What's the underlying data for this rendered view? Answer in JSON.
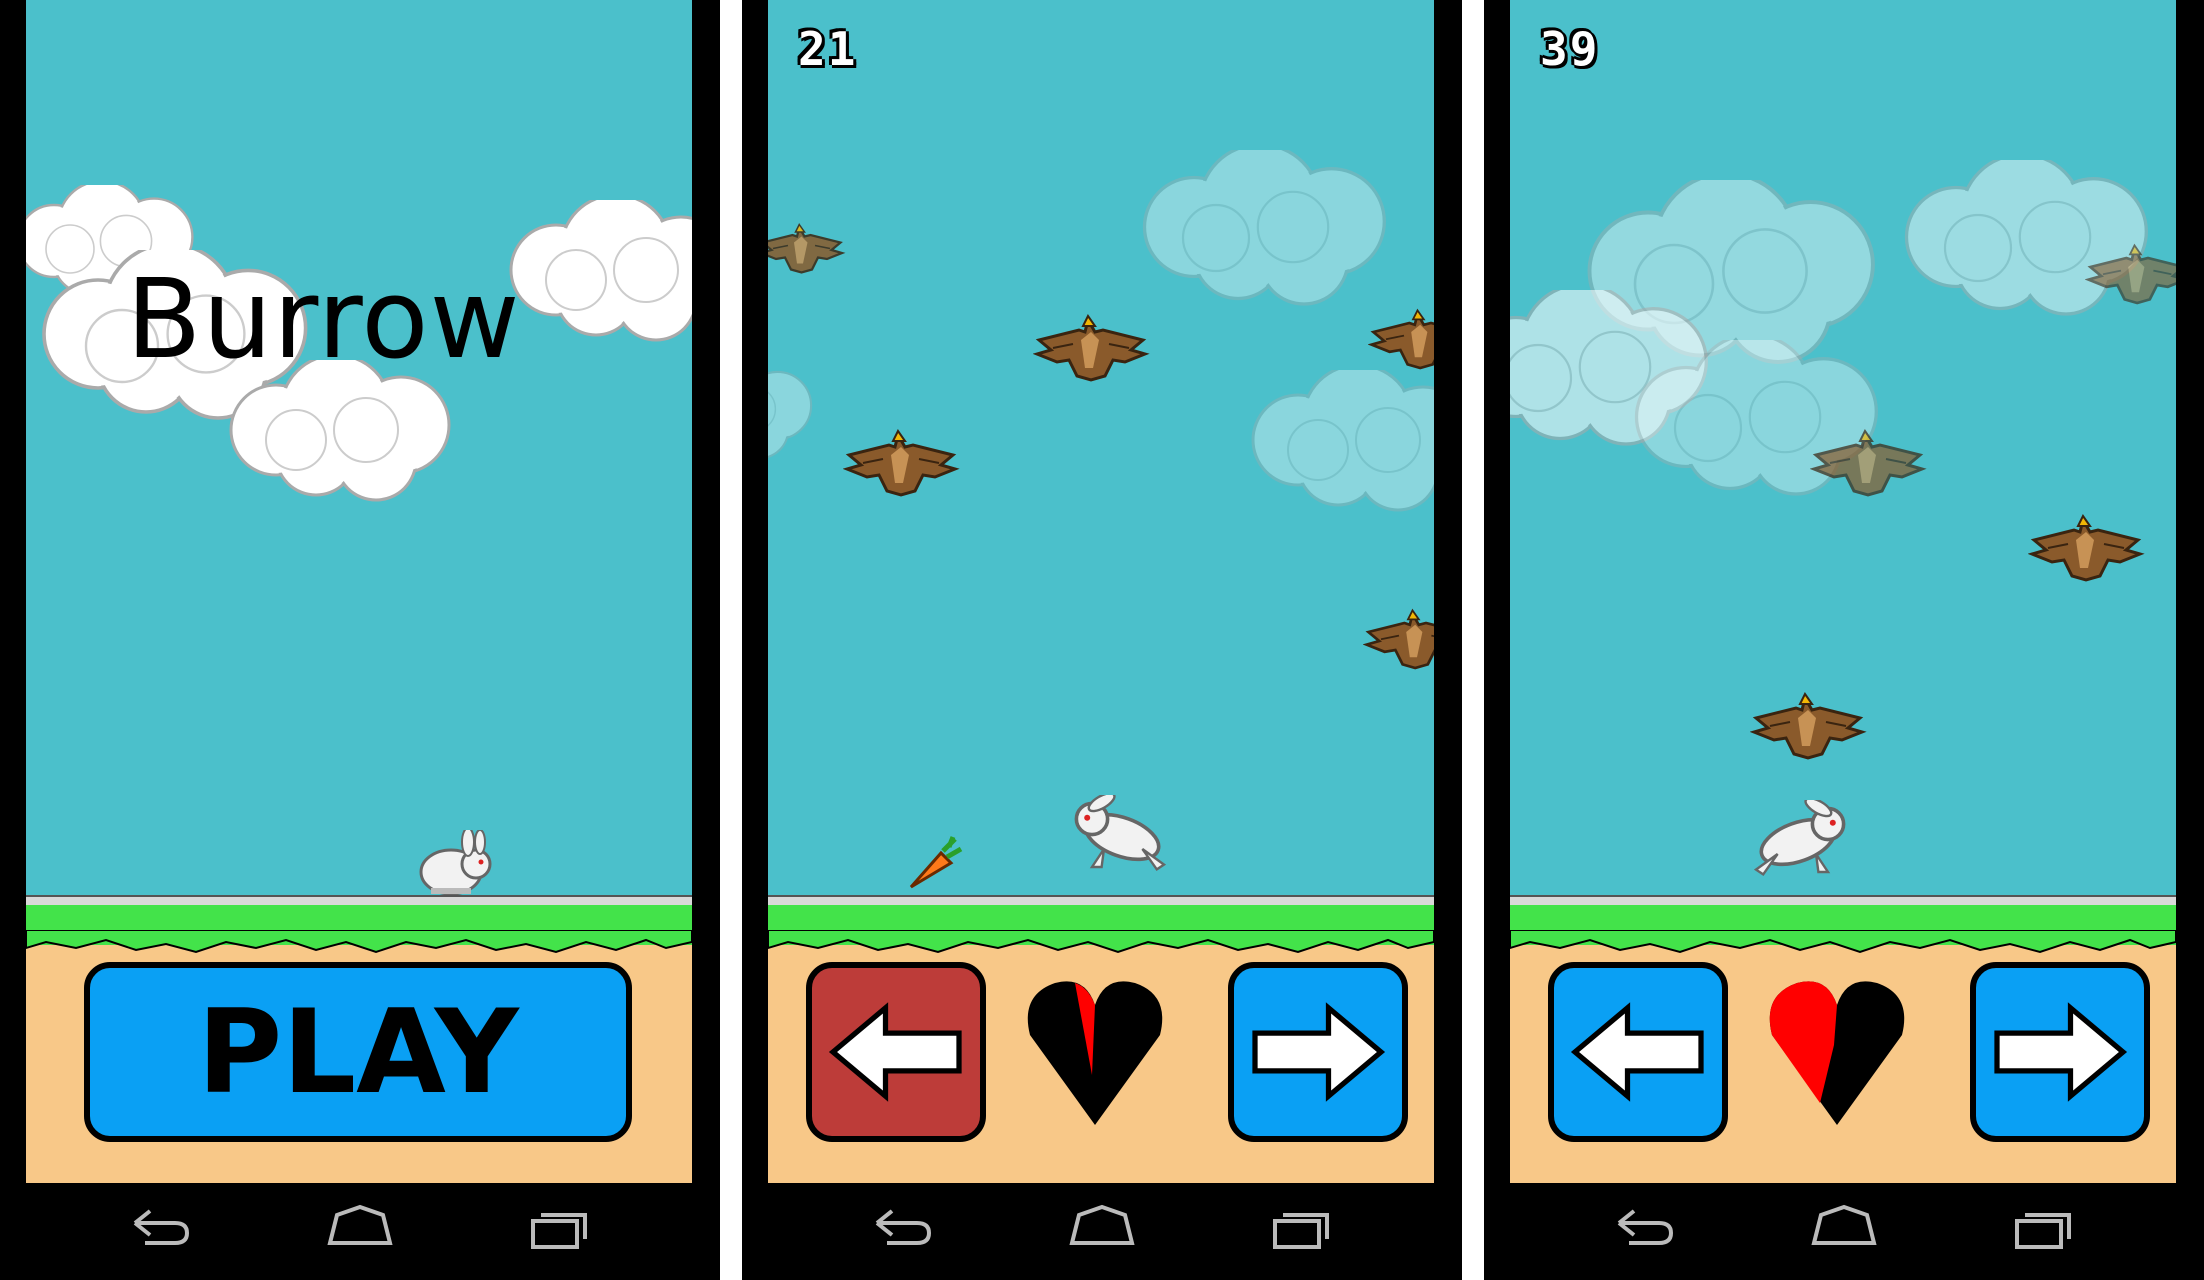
{
  "screens": [
    {
      "title": "Burrow",
      "play_label": "PLAY"
    },
    {
      "score": "21",
      "left_button_pressed": true,
      "health_fraction": 0.12,
      "entities": [
        "hawk-icon",
        "hawk-icon",
        "hawk-icon",
        "hawk-icon",
        "hawk-icon",
        "carrot-icon",
        "rabbit-icon"
      ]
    },
    {
      "score": "39",
      "left_button_pressed": false,
      "health_fraction": 0.45,
      "entities": [
        "hawk-icon",
        "hawk-icon",
        "hawk-icon",
        "hawk-icon",
        "rabbit-icon"
      ]
    }
  ],
  "navbar": {
    "icons": [
      "back-icon",
      "home-icon",
      "recent-apps-icon"
    ]
  },
  "colors": {
    "sky": "#4bc0cb",
    "grass": "#43e34a",
    "dirt": "#f8c888",
    "button_blue": "#0aa0f4",
    "button_pressed": "#bd3c39",
    "heart_red": "#ff0000",
    "hawk_brown": "#8a5a2b"
  }
}
